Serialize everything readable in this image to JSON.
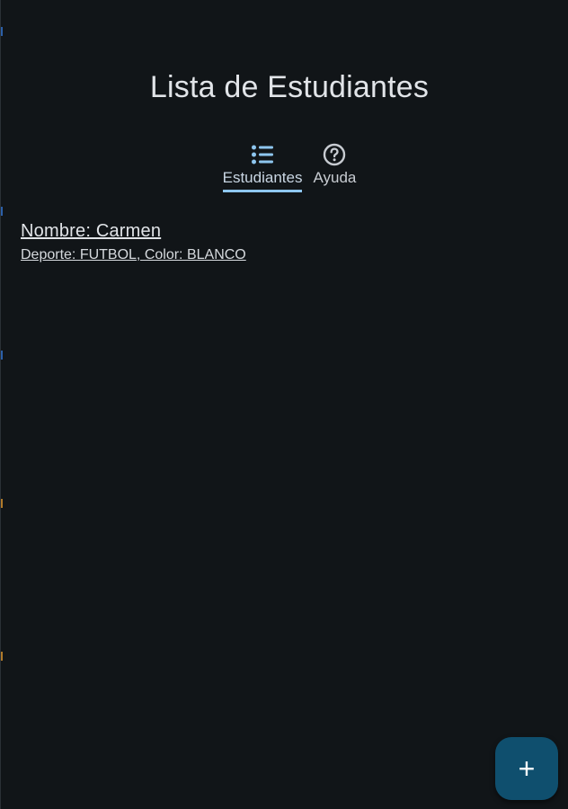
{
  "header": {
    "title": "Lista de Estudiantes"
  },
  "tabs": [
    {
      "label": "Estudiantes",
      "icon": "list-icon",
      "active": true
    },
    {
      "label": "Ayuda",
      "icon": "help-icon",
      "active": false
    }
  ],
  "students": [
    {
      "name_line": "Nombre: Carmen",
      "detail_line": "Deporte: FUTBOL, Color: BLANCO"
    }
  ],
  "fab": {
    "icon": "plus-icon",
    "symbol": "+"
  },
  "colors": {
    "background": "#111518",
    "accent": "#8ec6ef",
    "fab": "#0f4f6e",
    "text": "#e1e4e8"
  }
}
